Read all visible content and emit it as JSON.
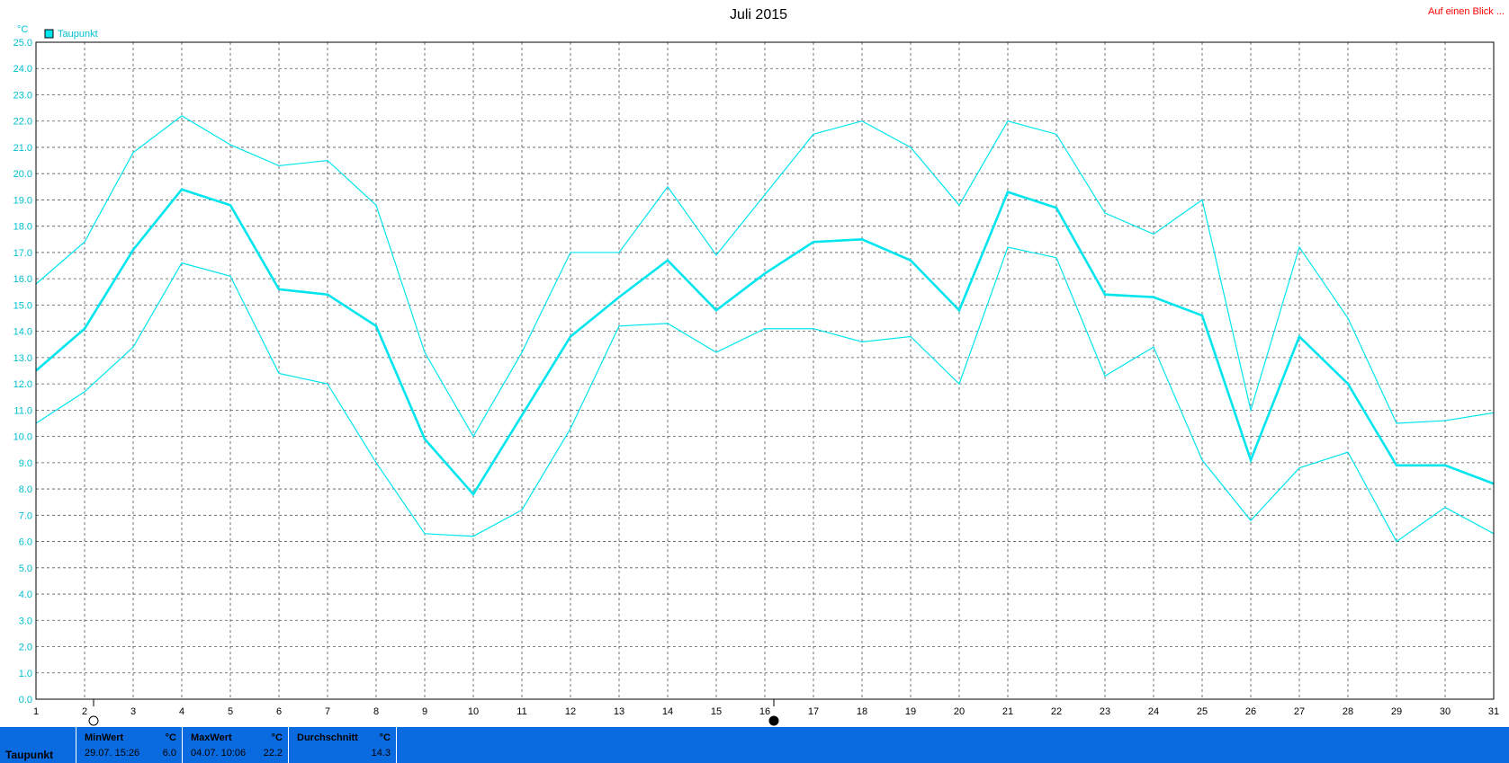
{
  "header": {
    "title": "Juli 2015",
    "link": "Auf einen Blick ..."
  },
  "legend": {
    "label": "Taupunkt",
    "color": "#00e5ee"
  },
  "chart_data": {
    "type": "line",
    "title": "Juli 2015",
    "ylabel": "°C",
    "xlabel": "",
    "ylim": [
      0,
      25
    ],
    "ytick_step": 1,
    "x": [
      1,
      2,
      3,
      4,
      5,
      6,
      7,
      8,
      9,
      10,
      11,
      12,
      13,
      14,
      15,
      16,
      17,
      18,
      19,
      20,
      21,
      22,
      23,
      24,
      25,
      26,
      27,
      28,
      29,
      30,
      31
    ],
    "grid": true,
    "legend_position": "top-left",
    "series": [
      {
        "name": "Taupunkt",
        "role": "mean",
        "color": "#00e5ee",
        "values": [
          12.5,
          14.1,
          17.1,
          19.4,
          18.8,
          15.6,
          15.4,
          14.2,
          9.9,
          7.8,
          10.8,
          13.8,
          15.3,
          16.7,
          14.8,
          16.2,
          17.4,
          17.5,
          16.7,
          14.8,
          19.3,
          18.7,
          15.4,
          15.3,
          14.6,
          9.1,
          13.8,
          12.0,
          8.9,
          8.9,
          8.2
        ]
      },
      {
        "role": "max",
        "color": "#00e5ee",
        "values": [
          15.8,
          17.4,
          20.8,
          22.2,
          21.1,
          20.3,
          20.5,
          18.8,
          13.2,
          10.0,
          13.2,
          17.0,
          17.0,
          19.5,
          16.9,
          19.2,
          21.5,
          22.0,
          21.0,
          18.8,
          22.0,
          21.5,
          18.5,
          17.7,
          19.0,
          11.0,
          17.2,
          14.5,
          10.5,
          10.6,
          10.9
        ]
      },
      {
        "role": "min",
        "color": "#00e5ee",
        "values": [
          10.5,
          11.7,
          13.4,
          16.6,
          16.1,
          12.4,
          12.0,
          9.0,
          6.3,
          6.2,
          7.2,
          10.3,
          14.2,
          14.3,
          13.2,
          14.1,
          14.1,
          13.6,
          13.8,
          12.0,
          17.2,
          16.8,
          12.3,
          13.4,
          9.1,
          6.8,
          8.8,
          9.4,
          6.0,
          7.3,
          6.3
        ]
      }
    ],
    "markers": [
      {
        "day": 2,
        "symbol": "new-moon"
      },
      {
        "day": 16,
        "symbol": "full-moon"
      }
    ]
  },
  "stats": {
    "row_label": "Taupunkt",
    "min": {
      "header": "MinWert",
      "unit": "°C",
      "date": "29.07.  15:26",
      "value": "6.0"
    },
    "max": {
      "header": "MaxWert",
      "unit": "°C",
      "date": "04.07.  10:06",
      "value": "22.2"
    },
    "avg": {
      "header": "Durchschnitt",
      "unit": "°C",
      "value": "14.3"
    }
  }
}
